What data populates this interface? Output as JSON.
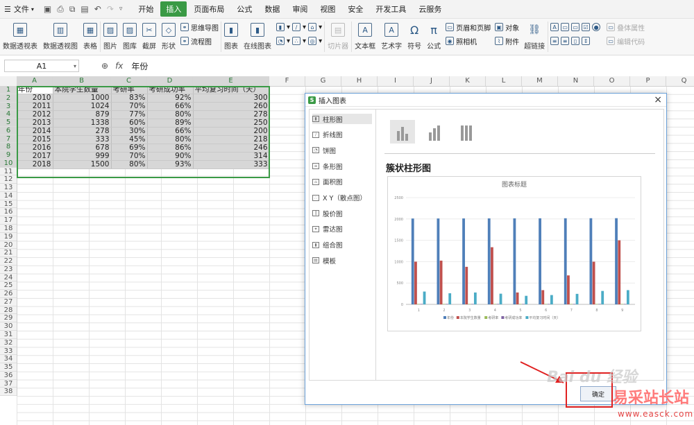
{
  "menu": {
    "file_label": "文件",
    "tabs": [
      "开始",
      "插入",
      "页面布局",
      "公式",
      "数据",
      "审阅",
      "视图",
      "安全",
      "开发工具",
      "云服务"
    ],
    "active_tab": "插入"
  },
  "ribbon": {
    "pivot_table": "数据透视表",
    "pivot_chart": "数据透视图",
    "table": "表格",
    "picture": "图片",
    "gallery": "图库",
    "screenshot": "截屏",
    "shape": "形状",
    "mindmap": "思维导图",
    "flowchart": "流程图",
    "chart": "图表",
    "online_chart": "在线图表",
    "slicer": "切片器",
    "textbox": "文本框",
    "wordart": "艺术字",
    "symbol": "符号",
    "formula": "公式",
    "header_footer": "页眉和页脚",
    "camera": "照相机",
    "object": "对象",
    "attachment": "附件",
    "hyperlink": "超链接",
    "form_field_1": "叠体属性",
    "form_field_2": "编辑代码"
  },
  "formula_bar": {
    "cell_ref": "A1",
    "fx": "fx",
    "value": "年份"
  },
  "sheet": {
    "columns": [
      "A",
      "B",
      "C",
      "D",
      "E",
      "F",
      "G",
      "H",
      "I",
      "J",
      "K",
      "L",
      "M",
      "N",
      "O",
      "P",
      "Q"
    ],
    "rows": [
      "1",
      "2",
      "3",
      "4",
      "5",
      "6",
      "7",
      "8",
      "9",
      "10",
      "11",
      "12",
      "13",
      "14",
      "15",
      "16",
      "17",
      "18",
      "19",
      "20",
      "21",
      "22",
      "23",
      "24",
      "25",
      "26",
      "27",
      "28",
      "29",
      "30",
      "31",
      "32",
      "33",
      "34",
      "35",
      "36",
      "37",
      "38"
    ],
    "headers": [
      "年份",
      "本院学生数量",
      "考研率",
      "考研成功率",
      "平均复习时间（天）"
    ],
    "data": [
      [
        "2010",
        "1000",
        "83%",
        "92%",
        "300"
      ],
      [
        "2011",
        "1024",
        "70%",
        "66%",
        "260"
      ],
      [
        "2012",
        "879",
        "77%",
        "80%",
        "278"
      ],
      [
        "2013",
        "1338",
        "60%",
        "89%",
        "250"
      ],
      [
        "2014",
        "278",
        "30%",
        "66%",
        "200"
      ],
      [
        "2015",
        "333",
        "45%",
        "80%",
        "218"
      ],
      [
        "2016",
        "678",
        "69%",
        "86%",
        "246"
      ],
      [
        "2017",
        "999",
        "70%",
        "90%",
        "314"
      ],
      [
        "2018",
        "1500",
        "80%",
        "93%",
        "333"
      ]
    ]
  },
  "dialog": {
    "title": "插入图表",
    "chart_types": [
      "柱形图",
      "折线图",
      "饼图",
      "条形图",
      "面积图",
      "X Y（散点图）",
      "股价图",
      "雷达图",
      "组合图",
      "模板"
    ],
    "selected_type": "柱形图",
    "preview_heading": "簇状柱形图",
    "ok_label": "确定"
  },
  "chart_data": {
    "type": "bar",
    "title": "图表标题",
    "categories": [
      "1",
      "2",
      "3",
      "4",
      "5",
      "6",
      "7",
      "8",
      "9"
    ],
    "ylim": [
      0,
      2500
    ],
    "yticks": [
      0,
      500,
      1000,
      1500,
      2000,
      2500
    ],
    "legend_position": "bottom",
    "series": [
      {
        "name": "年份",
        "color": "#4f7fb9",
        "values": [
          2010,
          2011,
          2012,
          2013,
          2014,
          2015,
          2016,
          2017,
          2018
        ]
      },
      {
        "name": "本院学生数量",
        "color": "#c0504d",
        "values": [
          1000,
          1024,
          879,
          1338,
          278,
          333,
          678,
          999,
          1500
        ]
      },
      {
        "name": "考研率",
        "color": "#9bbb59",
        "values": [
          0.83,
          0.7,
          0.77,
          0.6,
          0.3,
          0.45,
          0.69,
          0.7,
          0.8
        ]
      },
      {
        "name": "考研成功率",
        "color": "#7f64a2",
        "values": [
          0.92,
          0.66,
          0.8,
          0.89,
          0.66,
          0.8,
          0.86,
          0.9,
          0.93
        ]
      },
      {
        "name": "平均复习时间（天）",
        "color": "#4bacc6",
        "values": [
          300,
          260,
          278,
          250,
          200,
          218,
          246,
          314,
          333
        ]
      }
    ]
  },
  "watermark": {
    "baidu": "Bai du 经验",
    "site_name": "易采站长站",
    "site_url": "www.easck.com"
  }
}
